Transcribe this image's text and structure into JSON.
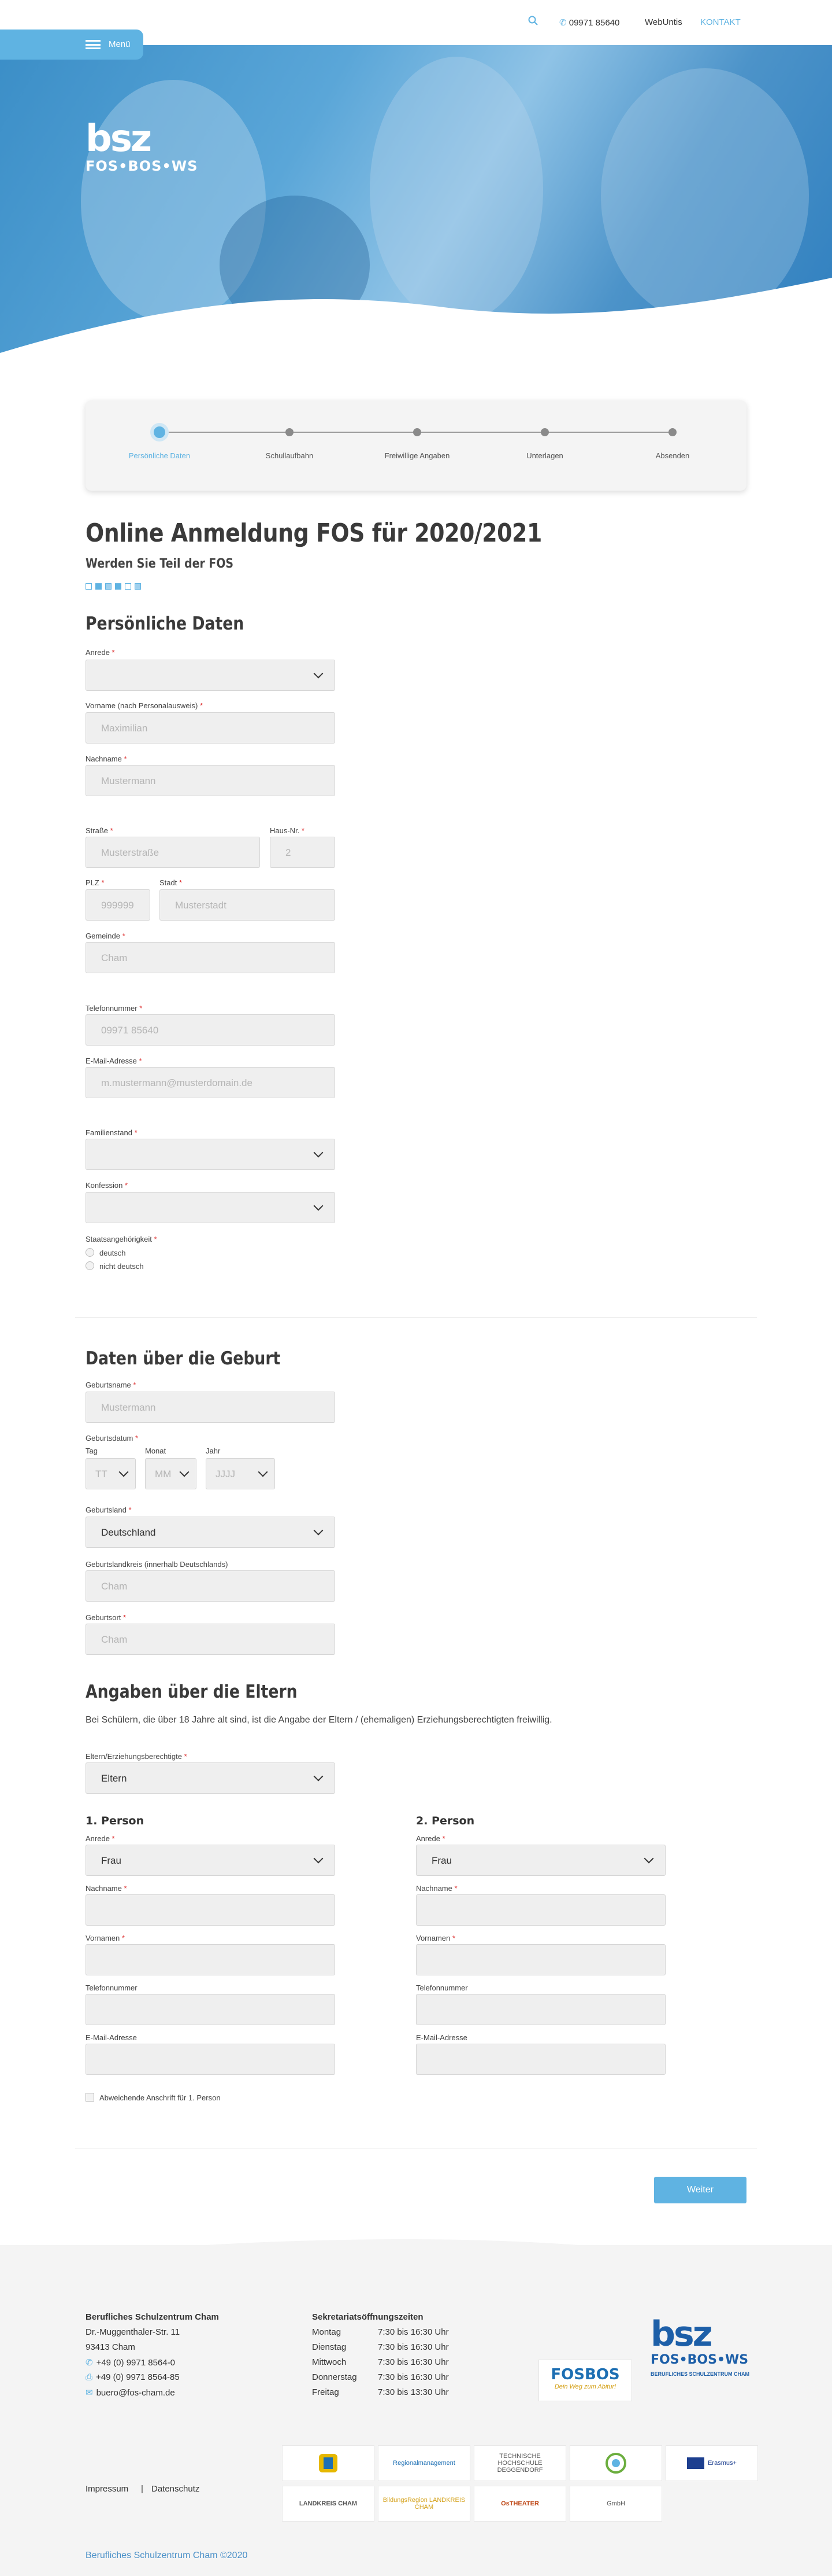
{
  "header": {
    "phone": "09971 85640",
    "webuntis": "WebUntis",
    "kontakt": "KONTAKT",
    "menu": "Menü"
  },
  "logo": {
    "main": "bsz",
    "sub": "FOS•BOS•WS"
  },
  "steps": [
    "Persönliche Daten",
    "Schullaufbahn",
    "Freiwillige Angaben",
    "Unterlagen",
    "Absenden"
  ],
  "page": {
    "title": "Online Anmeldung FOS für 2020/2021",
    "subtitle": "Werden Sie Teil der FOS"
  },
  "personal": {
    "title": "Persönliche Daten",
    "anrede": {
      "label": "Anrede",
      "value": ""
    },
    "vorname": {
      "label": "Vorname (nach Personalausweis)",
      "placeholder": "Maximilian"
    },
    "nachname": {
      "label": "Nachname",
      "placeholder": "Mustermann"
    },
    "strasse": {
      "label": "Straße",
      "placeholder": "Musterstraße"
    },
    "hausnr": {
      "label": "Haus-Nr.",
      "placeholder": "2"
    },
    "plz": {
      "label": "PLZ",
      "placeholder": "999999"
    },
    "stadt": {
      "label": "Stadt",
      "placeholder": "Musterstadt"
    },
    "gemeinde": {
      "label": "Gemeinde",
      "placeholder": "Cham"
    },
    "telefon": {
      "label": "Telefonnummer",
      "placeholder": "09971 85640"
    },
    "email": {
      "label": "E-Mail-Adresse",
      "placeholder": "m.mustermann@musterdomain.de"
    },
    "familienstand": {
      "label": "Familienstand",
      "value": ""
    },
    "konfession": {
      "label": "Konfession",
      "value": ""
    },
    "staat": {
      "label": "Staatsangehörigkeit",
      "options": [
        "deutsch",
        "nicht deutsch"
      ]
    }
  },
  "birth": {
    "title": "Daten über die Geburt",
    "geburtsname": {
      "label": "Geburtsname",
      "placeholder": "Mustermann"
    },
    "geburtsdatum": {
      "label": "Geburtsdatum",
      "tag": "Tag",
      "monat": "Monat",
      "jahr": "Jahr",
      "tag_ph": "TT",
      "monat_ph": "MM",
      "jahr_ph": "JJJJ"
    },
    "geburtsland": {
      "label": "Geburtsland",
      "value": "Deutschland"
    },
    "geburtslandkreis": {
      "label": "Geburtslandkreis (innerhalb Deutschlands)",
      "placeholder": "Cham"
    },
    "geburtsort": {
      "label": "Geburtsort",
      "placeholder": "Cham"
    }
  },
  "parents": {
    "title": "Angaben über die Eltern",
    "info": "Bei Schülern, die über 18 Jahre alt sind, ist die Angabe der Eltern / (ehemaligen) Erziehungsberechtigten freiwillig.",
    "erz": {
      "label": "Eltern/Erziehungsberechtigte",
      "value": "Eltern"
    },
    "person1": {
      "title": "1. Person",
      "anrede_label": "Anrede",
      "anrede": "Frau",
      "nachname": "Nachname",
      "vornamen": "Vornamen",
      "telefon": "Telefonnummer",
      "email": "E-Mail-Adresse"
    },
    "person2": {
      "title": "2. Person",
      "anrede_label": "Anrede",
      "anrede": "Frau",
      "nachname": "Nachname",
      "vornamen": "Vornamen",
      "telefon": "Telefonnummer",
      "email": "E-Mail-Adresse"
    },
    "abweichend": "Abweichende Anschrift für 1. Person"
  },
  "weiter": "Weiter",
  "footer": {
    "name": "Berufliches Schulzentrum Cham",
    "street": "Dr.-Muggenthaler-Str. 11",
    "city": "93413 Cham",
    "phone": "+49 (0) 9971 8564-0",
    "fax": "+49 (0) 9971 8564-85",
    "email": "buero@fos-cham.de",
    "hours_title": "Sekretariatsöffnungszeiten",
    "hours": [
      {
        "day": "Montag",
        "time": "7:30 bis 16:30 Uhr"
      },
      {
        "day": "Dienstag",
        "time": "7:30 bis 16:30 Uhr"
      },
      {
        "day": "Mittwoch",
        "time": "7:30 bis 16:30 Uhr"
      },
      {
        "day": "Donnerstag",
        "time": "7:30 bis 16:30 Uhr"
      },
      {
        "day": "Freitag",
        "time": "7:30 bis 13:30 Uhr"
      }
    ],
    "fosbos": "FOSBOS",
    "fosbos_tag": "Dein Weg zum Abitur!",
    "logo_sub": "BERUFLICHES SCHULZENTRUM CHAM",
    "impressum": "Impressum",
    "datenschutz": "Datenschutz",
    "partners": [
      "",
      "Regionalmanagement",
      "TECHNISCHE HOCHSCHULE DEGGENDORF",
      "",
      "Erasmus+",
      "LANDKREIS CHAM",
      "BildungsRegion LANDKREIS CHAM",
      "OsTHEATER",
      "GmbH"
    ],
    "copyright": "Berufliches Schulzentrum Cham ©2020"
  }
}
